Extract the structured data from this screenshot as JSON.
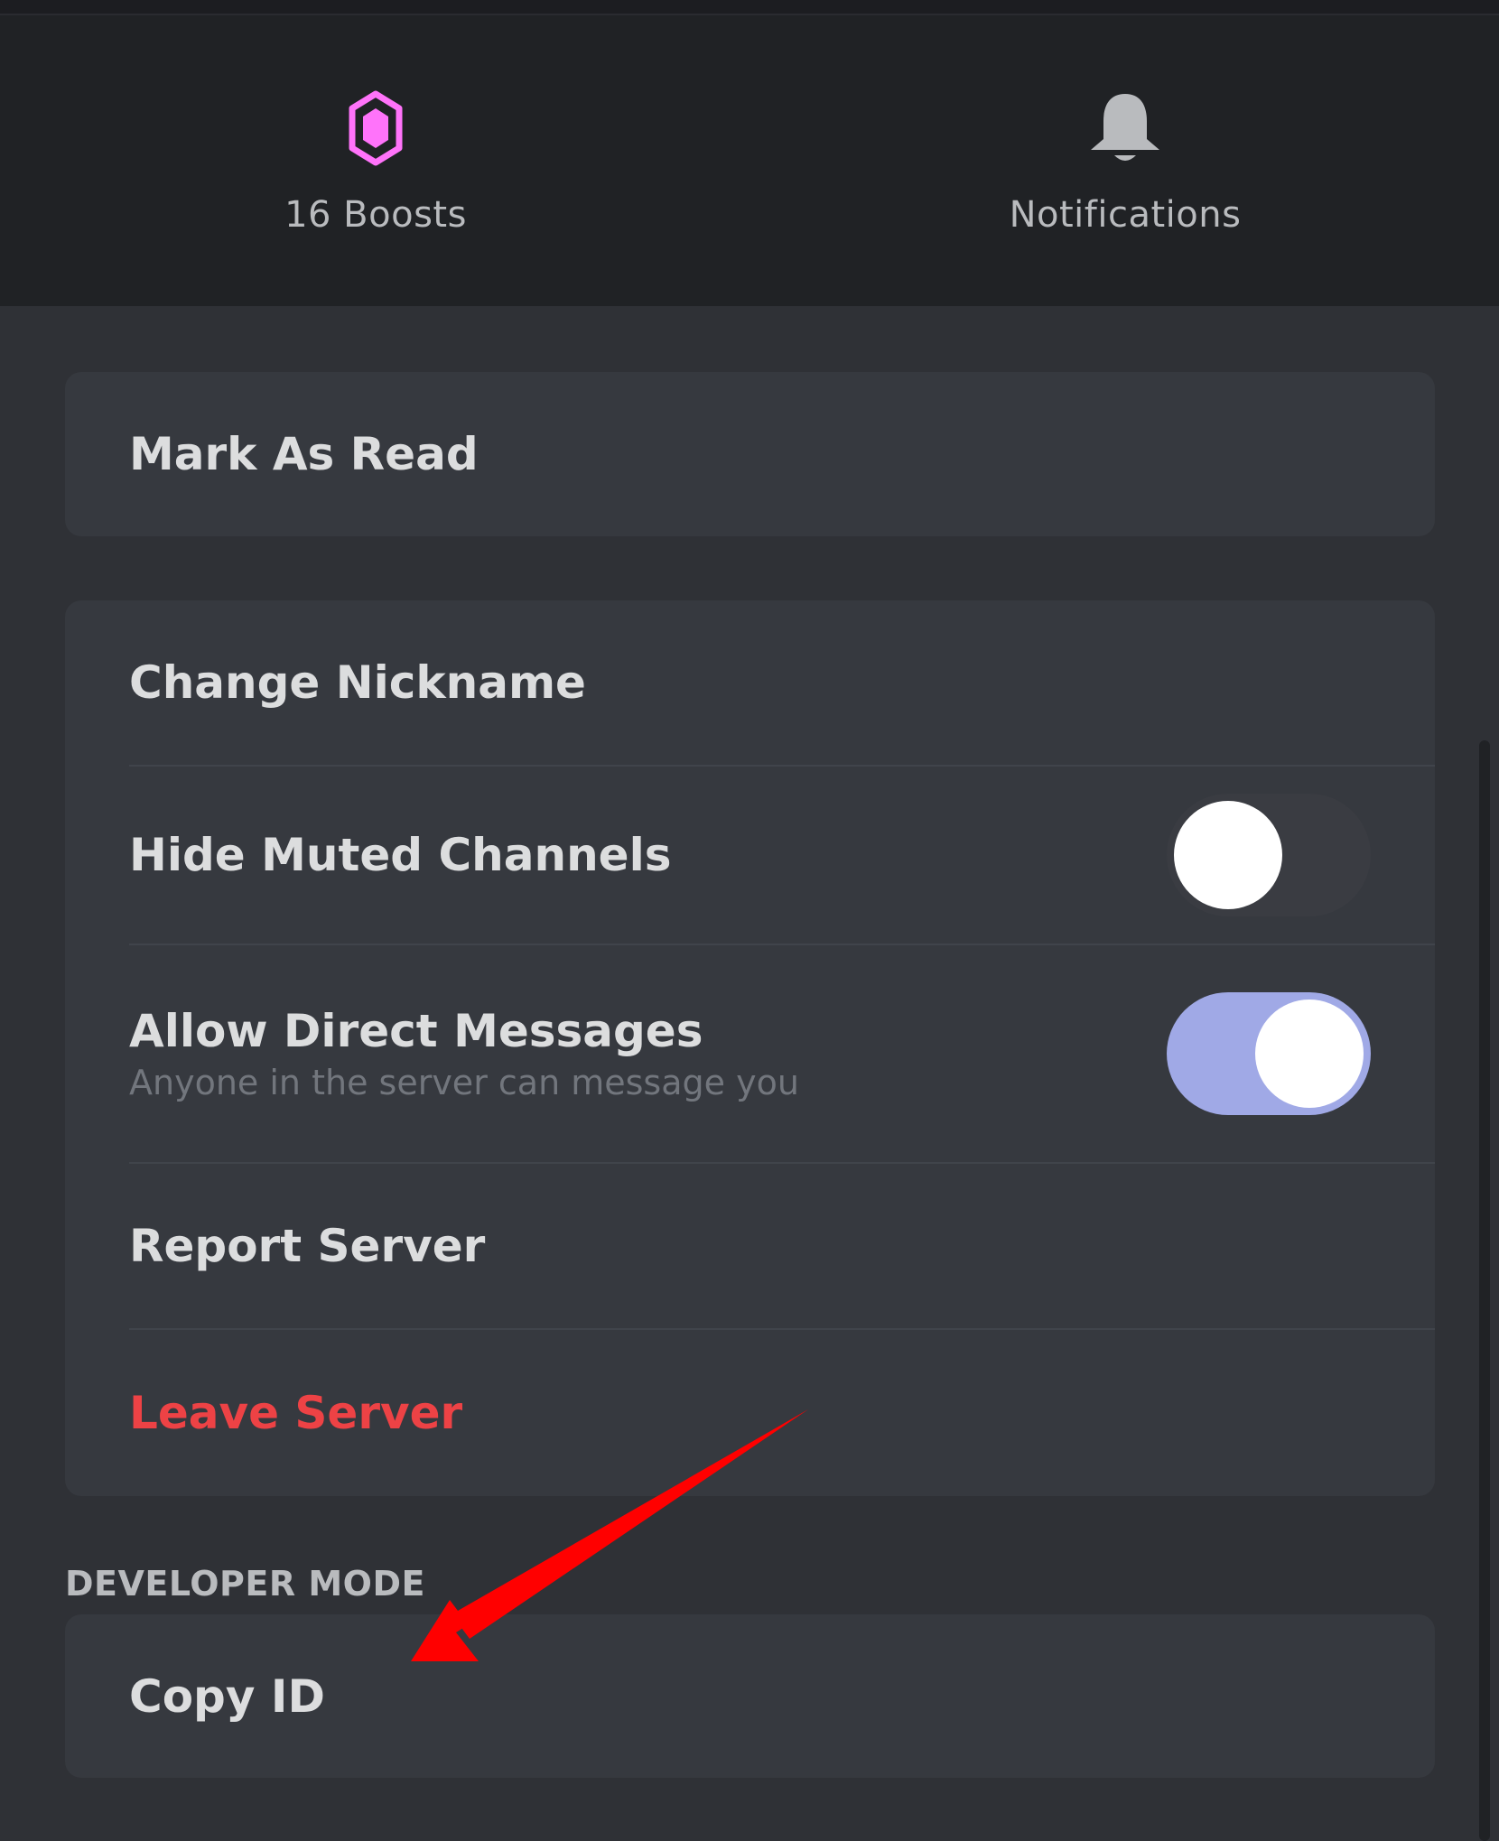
{
  "header": {
    "boosts": {
      "label": "16 Boosts",
      "icon": "boost-gem-icon",
      "icon_color": "#ff73fa"
    },
    "notifications": {
      "label": "Notifications",
      "icon": "bell-icon",
      "icon_color": "#b9bbbe"
    }
  },
  "menu": {
    "mark_as_read": "Mark As Read",
    "change_nickname": "Change Nickname",
    "hide_muted_channels": {
      "label": "Hide Muted Channels",
      "enabled": false
    },
    "allow_direct_messages": {
      "label": "Allow Direct Messages",
      "description": "Anyone in the server can message you",
      "enabled": true
    },
    "report_server": "Report Server",
    "leave_server": "Leave Server"
  },
  "developer_mode": {
    "section_title": "DEVELOPER MODE",
    "copy_id": "Copy ID"
  },
  "annotation": {
    "type": "arrow",
    "color": "#ff0000",
    "points_to": "Copy ID"
  },
  "colors": {
    "background": "#2f3136",
    "header_background": "#202225",
    "card_background": "#36393f",
    "danger": "#ed4245",
    "toggle_on": "#a0a9e6"
  }
}
